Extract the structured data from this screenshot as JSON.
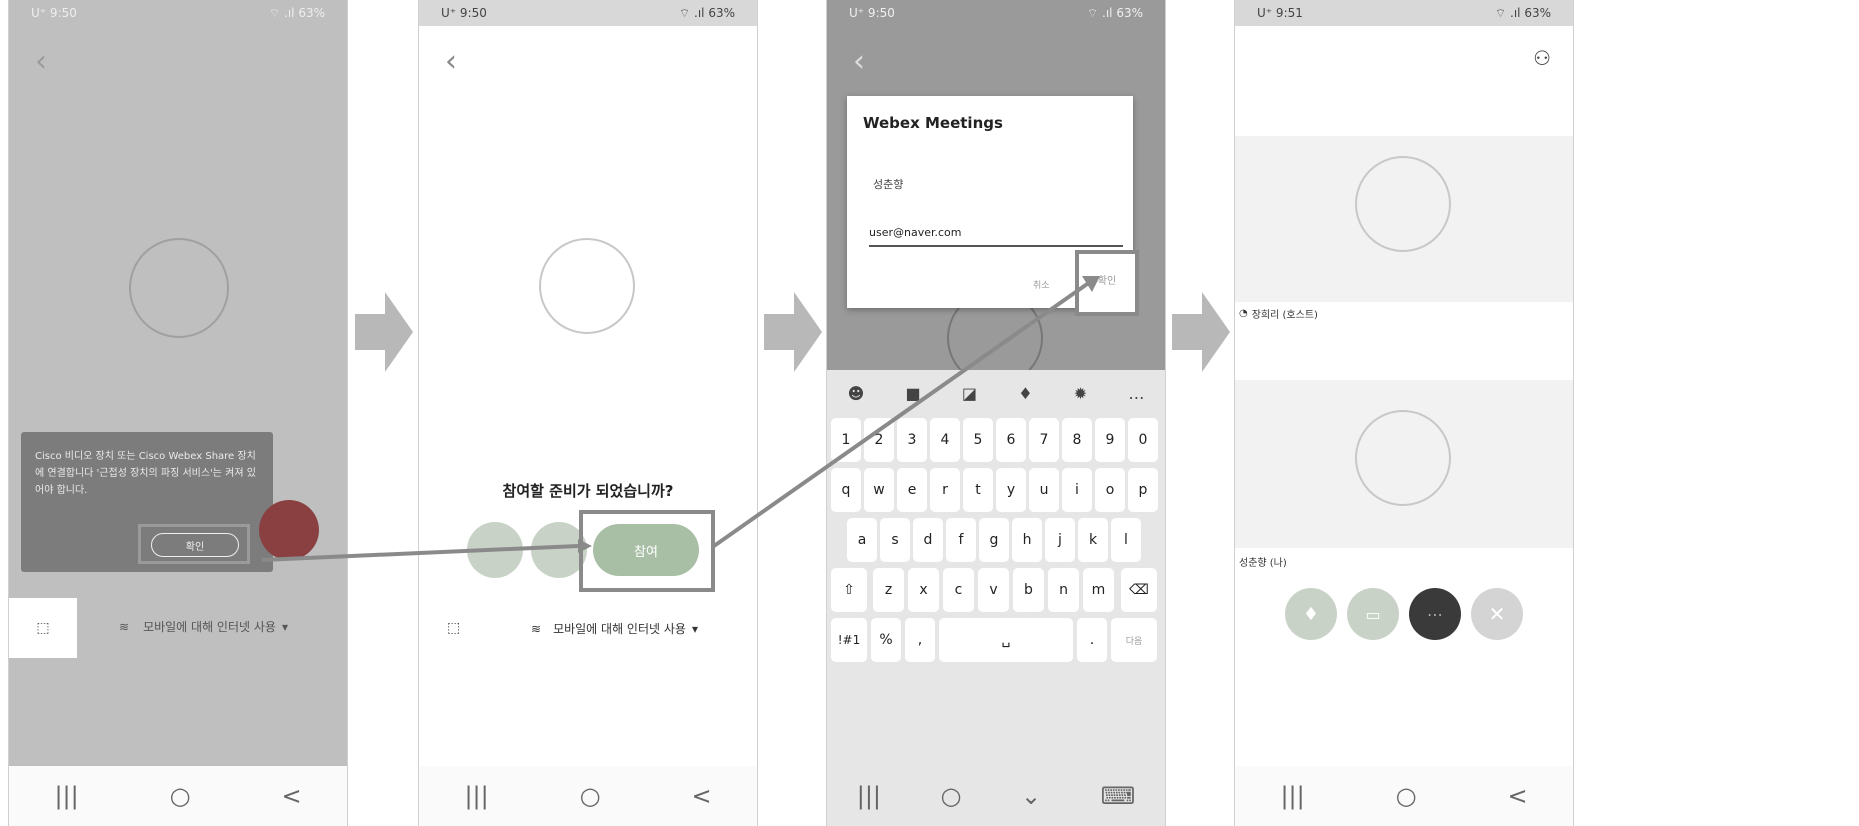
{
  "colors": {
    "dim_overlay": "#8a8a8a",
    "highlight": "#8a8a8a",
    "join_green": "#a8bfa6",
    "arrow_gray": "#b8b8b8",
    "end_red": "#a8a8a8",
    "more_dark": "#3a3a3a"
  },
  "p1": {
    "status_left": "U⁺ 9:50",
    "status_right": "⌔ .ıl 63%",
    "dialog_text": "Cisco 비디오 장치 또는 Cisco Webex Share 장치에 연결합니다 '근접성 장치의 파징 서비스'는 켜져 있어야 합니다.",
    "ok_label": "확인",
    "wifi_text": "모바일에 대해 인터넷 사용",
    "cast_icon": "cast-icon"
  },
  "p2": {
    "status_left": "U⁺ 9:50",
    "status_right": "⌔ .ıl 63%",
    "question": "참여할 준비가 되었습니까?",
    "join_label": "참여",
    "wifi_text": "모바일에 대해 인터넷 사용"
  },
  "p3": {
    "status_left": "U⁺ 9:50",
    "status_right": "⌔ .ıl 63%",
    "dialog_title": "Webex Meetings",
    "name_value": "성춘향",
    "email_value": "user@naver.com",
    "cancel_label": "취소",
    "ok_label": "확인",
    "keys_row1": [
      "1",
      "2",
      "3",
      "4",
      "5",
      "6",
      "7",
      "8",
      "9",
      "0"
    ],
    "keys_row2": [
      "q",
      "w",
      "e",
      "r",
      "t",
      "y",
      "u",
      "i",
      "o",
      "p"
    ],
    "keys_row3": [
      "a",
      "s",
      "d",
      "f",
      "g",
      "h",
      "j",
      "k",
      "l"
    ],
    "keys_row4": [
      "z",
      "x",
      "c",
      "v",
      "b",
      "n",
      "m"
    ],
    "key_sym": "!#1",
    "key_comma": ",",
    "key_period": ".",
    "key_done": "다음"
  },
  "p4": {
    "status_left": "U⁺ 9:51",
    "status_right": "⌔ .ıl 63%",
    "host_label": "장희리 (호스트)",
    "me_label": "성춘향 (나)"
  },
  "nav": {
    "recent": "|||",
    "home": "○",
    "back": "<"
  }
}
